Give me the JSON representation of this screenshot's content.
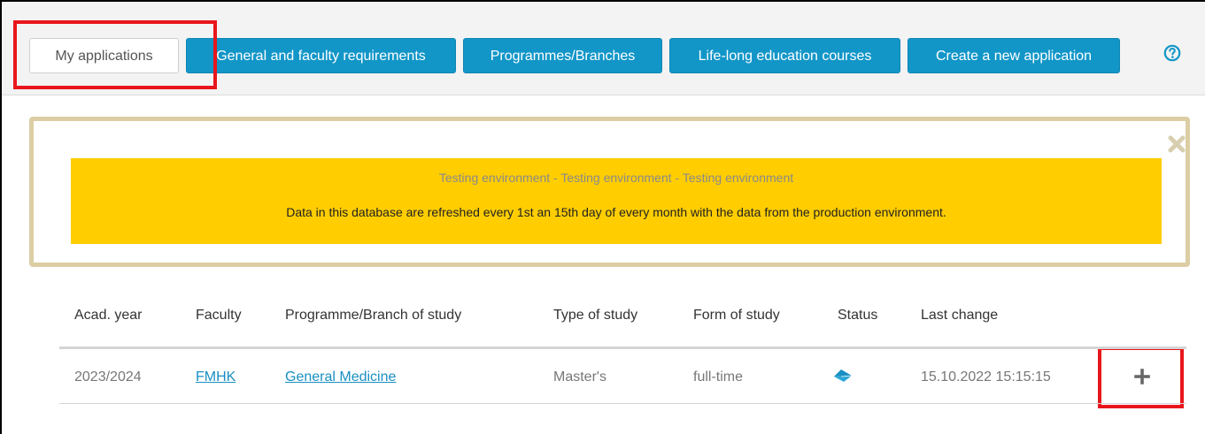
{
  "nav": {
    "tabs": [
      {
        "label": "My applications"
      },
      {
        "label": "General and faculty requirements"
      },
      {
        "label": "Programmes/Branches"
      },
      {
        "label": "Life-long education courses"
      },
      {
        "label": "Create a new application"
      }
    ],
    "help_icon": "question-circle-icon"
  },
  "notice": {
    "line1": "Testing environment - Testing environment - Testing environment",
    "line2": "Data in this database are refreshed every 1st an 15th day of every month with the data from the production environment.",
    "close_icon": "close-icon"
  },
  "table": {
    "headers": [
      "Acad. year",
      "Faculty",
      "Programme/Branch of study",
      "Type of study",
      "Form of study",
      "Status",
      "Last change"
    ],
    "rows": [
      {
        "acad_year": "2023/2024",
        "faculty": "FMHK",
        "programme": "General Medicine",
        "type": "Master's",
        "form": "full-time",
        "status_icon": "paper-plane-icon",
        "last_change": "15.10.2022 15:15:15",
        "action_icon": "plus-icon"
      }
    ]
  },
  "colors": {
    "accent": "#1296c8",
    "banner": "#ffcd00",
    "notice_border": "#dccda4",
    "highlight": "#e8161c"
  }
}
